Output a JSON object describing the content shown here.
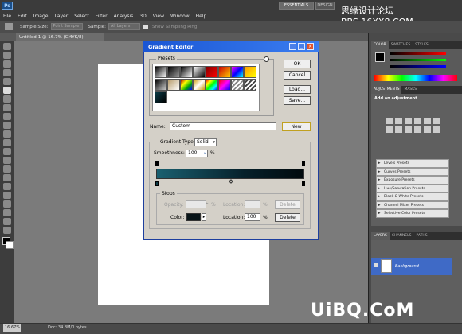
{
  "app": {
    "logo": "Ps",
    "workspace_buttons": [
      "ESSENTIALS",
      "DESIGN"
    ],
    "watermark_top": "思缘设计论坛 BBS.16XX8.COM",
    "menu": [
      "File",
      "Edit",
      "Image",
      "Layer",
      "Select",
      "Filter",
      "Analysis",
      "3D",
      "View",
      "Window",
      "Help"
    ]
  },
  "options_bar": {
    "sample_size_label": "Sample Size:",
    "sample_size_value": "Point Sample",
    "sample_label": "Sample:",
    "sample_value": "All Layers",
    "show_ring_label": "Show Sampling Ring"
  },
  "document": {
    "tab_title": "Untitled-1 @ 16.7% (CMYK/8)",
    "zoom": "16.67%",
    "status": "Doc: 34.8M/0 bytes"
  },
  "panels": {
    "color_tabs": [
      "COLOR",
      "SWATCHES",
      "STYLES"
    ],
    "adjust_tabs": [
      "ADJUSTMENTS",
      "MASKS"
    ],
    "adjust_title": "Add an adjustment",
    "presets": [
      "Levels Presets",
      "Curves Presets",
      "Exposure Presets",
      "Hue/Saturation Presets",
      "Black & White Presets",
      "Channel Mixer Presets",
      "Selective Color Presets"
    ],
    "layers_tabs": [
      "LAYERS",
      "CHANNELS",
      "PATHS"
    ],
    "layer_name": "Background"
  },
  "dialog": {
    "title": "Gradient Editor",
    "presets_label": "Presets",
    "buttons": {
      "ok": "OK",
      "cancel": "Cancel",
      "load": "Load...",
      "save": "Save...",
      "new": "New",
      "delete": "Delete"
    },
    "name_label": "Name:",
    "name_value": "Custom",
    "gradient_type_label": "Gradient Type:",
    "gradient_type_value": "Solid",
    "smoothness_label": "Smoothness:",
    "smoothness_value": "100",
    "percent": "%",
    "stops_label": "Stops",
    "opacity_label": "Opacity:",
    "location_label": "Location:",
    "color_label": "Color:",
    "color_location_value": "100"
  },
  "watermark_bottom": "UiBQ.CoM",
  "colors": {
    "ramp_start": "#1a6070",
    "ramp_end": "#020a0d",
    "layer_highlight": "#3f6ac6"
  }
}
